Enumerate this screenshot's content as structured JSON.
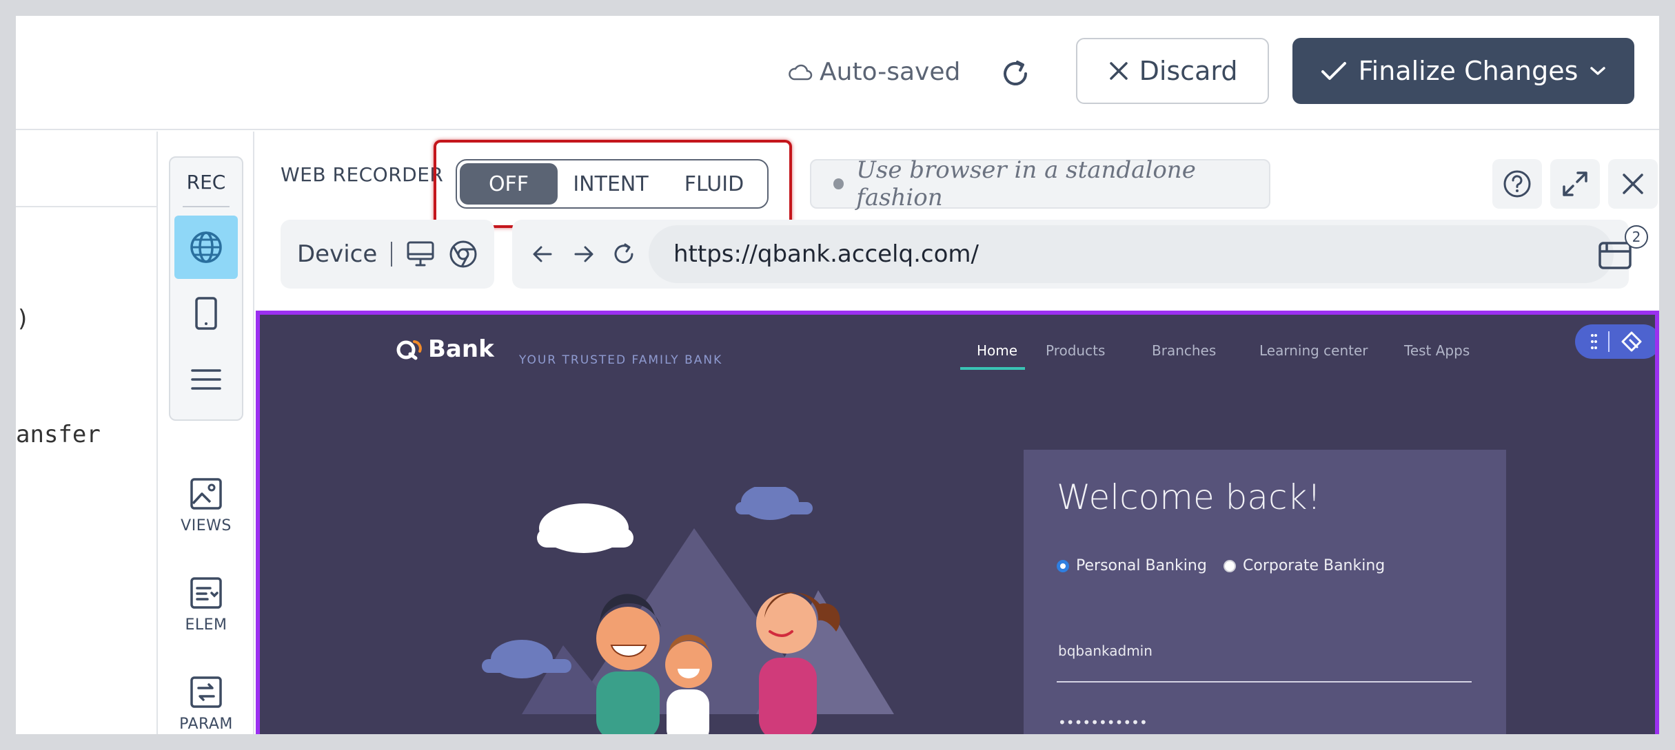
{
  "header": {
    "autosave_label": "Auto-saved",
    "discard_label": "Discard",
    "finalize_label": "Finalize Changes"
  },
  "left_panel": {
    "code_lines": [
      ")",
      "ansfer"
    ]
  },
  "rail": {
    "rec_label": "REC",
    "tools": [
      {
        "label": "VIEWS",
        "icon": "image-icon"
      },
      {
        "label": "ELEM",
        "icon": "element-icon"
      },
      {
        "label": "PARAM",
        "icon": "param-icon"
      }
    ]
  },
  "recorder": {
    "title": "WEB RECORDER",
    "modes": [
      "OFF",
      "INTENT",
      "FLUID"
    ],
    "active_mode": "OFF",
    "standalone_text": "Use browser in a standalone fashion",
    "device_label": "Device",
    "url": "https://qbank.accelq.com/",
    "tab_count": "2"
  },
  "site": {
    "logo_text": "Bank",
    "tagline": "YOUR TRUSTED FAMILY BANK",
    "nav": [
      "Home",
      "Products",
      "Branches",
      "Learning center",
      "Test Apps"
    ],
    "welcome": "Welcome back!",
    "radio_personal": "Personal Banking",
    "radio_corporate": "Corporate Banking",
    "username": "bqbankadmin",
    "password_mask": "•••••••••••"
  },
  "colors": {
    "accent_dark": "#3d4b62",
    "active_rail": "#8fd7f7",
    "highlight_red": "#c4161c",
    "site_border": "#9b30f0",
    "site_bg": "#403c5a"
  }
}
